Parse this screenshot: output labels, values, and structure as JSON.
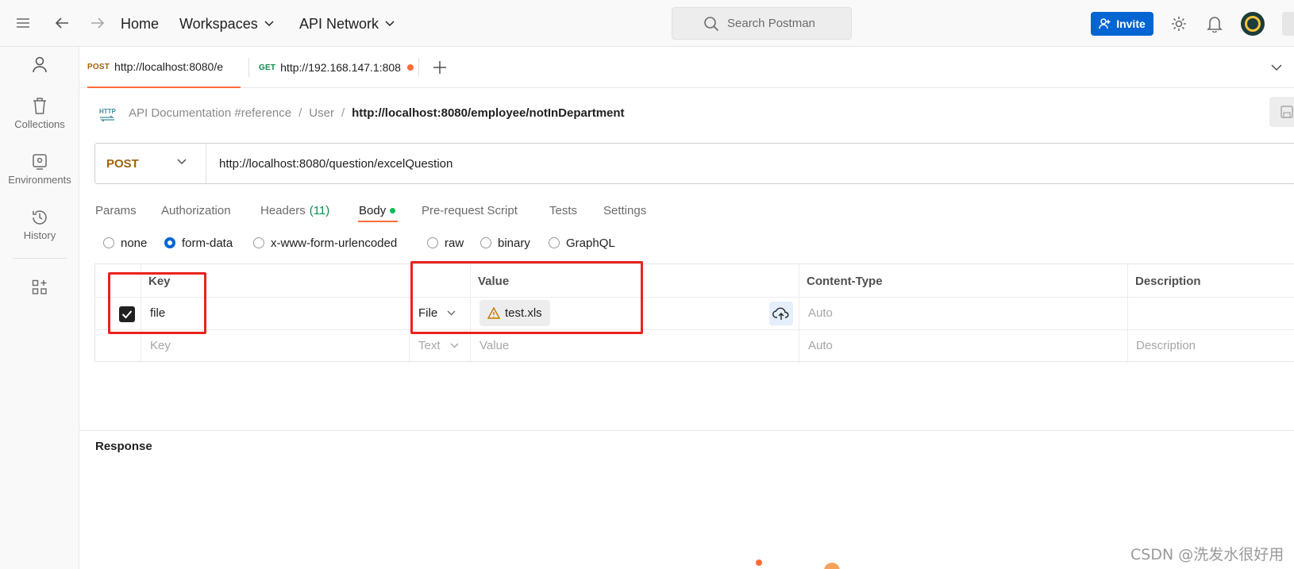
{
  "topbar": {
    "nav": {
      "home": "Home",
      "workspaces": "Workspaces",
      "api_network": "API Network"
    },
    "search_placeholder": "Search Postman",
    "invite_label": "Invite"
  },
  "sidebar": {
    "items": [
      {
        "label": "Collections"
      },
      {
        "label": "Environments"
      },
      {
        "label": "History"
      }
    ]
  },
  "tabs": [
    {
      "method": "POST",
      "title": "http://localhost:8080/e",
      "method_color": "#a0620c"
    },
    {
      "method": "GET",
      "title": "http://192.168.147.1:808",
      "method_color": "#0b8a4d",
      "unsaved": true
    }
  ],
  "breadcrumb": {
    "icon": "HTTP",
    "items": [
      "API Documentation #reference",
      "User"
    ],
    "current": "http://localhost:8080/employee/notInDepartment"
  },
  "request": {
    "method": "POST",
    "url": "http://localhost:8080/question/excelQuestion",
    "tabs": [
      {
        "label": "Params"
      },
      {
        "label": "Authorization"
      },
      {
        "label": "Headers",
        "count": "(11)"
      },
      {
        "label": "Body",
        "active": true
      },
      {
        "label": "Pre-request Script"
      },
      {
        "label": "Tests"
      },
      {
        "label": "Settings"
      }
    ],
    "body_types": [
      "none",
      "form-data",
      "x-www-form-urlencoded",
      "raw",
      "binary",
      "GraphQL"
    ],
    "body_type_selected": "form-data"
  },
  "form_table": {
    "headers": {
      "key": "Key",
      "value": "Value",
      "content_type": "Content-Type",
      "description": "Description"
    },
    "rows": [
      {
        "checked": true,
        "key": "file",
        "type": "File",
        "value": "test.xls",
        "content_type": "Auto",
        "description": ""
      }
    ],
    "new_row": {
      "key_placeholder": "Key",
      "type": "Text",
      "value_placeholder": "Value",
      "content_type": "Auto",
      "description_placeholder": "Description"
    }
  },
  "response": {
    "title": "Response"
  },
  "watermark": "CSDN @洗发水很好用",
  "colors": {
    "accent": "#ff6c37",
    "invite": "#0265d2",
    "annotation": "#e8231d"
  }
}
